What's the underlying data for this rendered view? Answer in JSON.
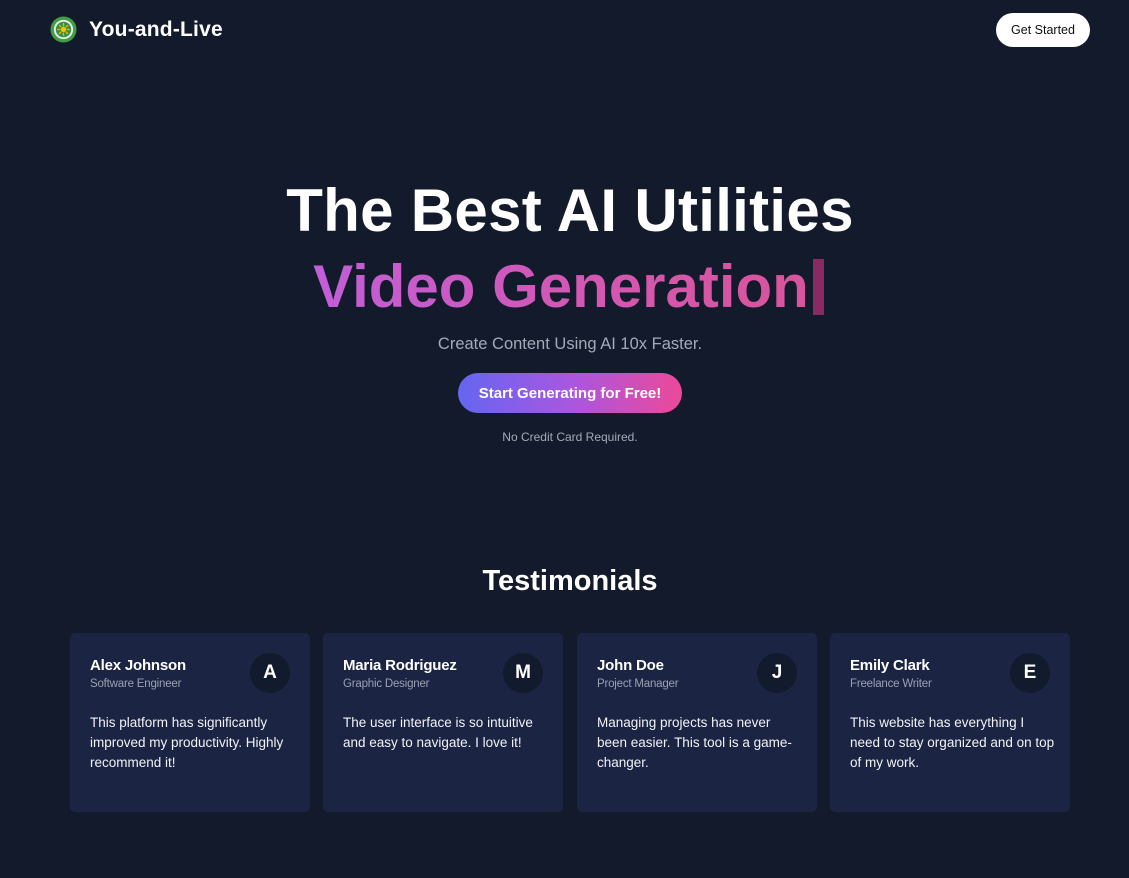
{
  "header": {
    "brand_name": "You-and-Live",
    "logo_icon": "sun-logo-icon",
    "get_started_label": "Get Started"
  },
  "hero": {
    "title": "The Best AI Utilities",
    "animated_text": "Video Generation",
    "tagline": "Create Content Using AI 10x Faster.",
    "cta_label": "Start Generating for Free!",
    "note": "No Credit Card Required."
  },
  "testimonials": {
    "title": "Testimonials",
    "items": [
      {
        "name": "Alex Johnson",
        "role": "Software Engineer",
        "initial": "A",
        "text": "This platform has significantly improved my productivity. Highly recommend it!"
      },
      {
        "name": "Maria Rodriguez",
        "role": "Graphic Designer",
        "initial": "M",
        "text": "The user interface is so intuitive and easy to navigate. I love it!"
      },
      {
        "name": "John Doe",
        "role": "Project Manager",
        "initial": "J",
        "text": "Managing projects has never been easier. This tool is a game-changer."
      },
      {
        "name": "Emily Clark",
        "role": "Freelance Writer",
        "initial": "E",
        "text": "This website has everything I need to stay organized and on top of my work."
      }
    ]
  },
  "colors": {
    "background": "#131a2b",
    "card_background": "#1b2442",
    "gradient_start": "#6466f1",
    "gradient_end": "#ec4999",
    "heading_gradient_start": "#c15ed8",
    "heading_gradient_end": "#d8549a"
  }
}
